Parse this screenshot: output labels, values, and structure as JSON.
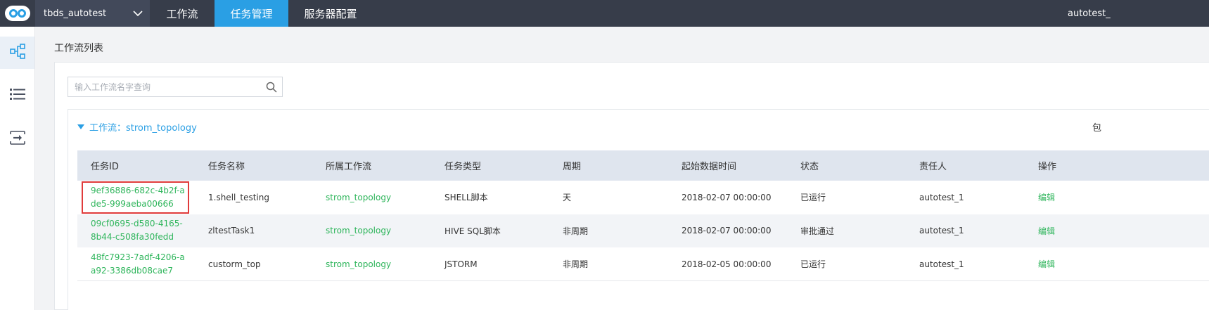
{
  "header": {
    "project": "tbds_autotest",
    "tabs": [
      {
        "label": "工作流"
      },
      {
        "label": "任务管理"
      },
      {
        "label": "服务器配置"
      }
    ],
    "user": "autotest_"
  },
  "sidebar": {
    "items": [
      "workflow-diagram-icon",
      "list-icon",
      "import-icon"
    ]
  },
  "page": {
    "title": "工作流列表",
    "search_placeholder": "输入工作流名字查询"
  },
  "workflow": {
    "header": "工作流：strom_topology",
    "right_text": "包"
  },
  "table": {
    "columns": [
      "任务ID",
      "任务名称",
      "所属工作流",
      "任务类型",
      "周期",
      "起始数据时间",
      "状态",
      "责任人",
      "操作"
    ],
    "rows": [
      {
        "id": "9ef36886-682c-4b2f-ade5-999aeba00666",
        "name": "1.shell_testing",
        "workflow": "strom_topology",
        "type": "SHELL脚本",
        "period": "天",
        "start_time": "2018-02-07 00:00:00",
        "status": "已运行",
        "owner": "autotest_1",
        "action": "编辑"
      },
      {
        "id": "09cf0695-d580-4165-8b44-c508fa30fedd",
        "name": "zltestTask1",
        "workflow": "strom_topology",
        "type": "HIVE SQL脚本",
        "period": "非周期",
        "start_time": "2018-02-07 00:00:00",
        "status": "审批通过",
        "owner": "autotest_1",
        "action": "编辑"
      },
      {
        "id": "48fc7923-7adf-4206-aa92-3386db08cae7",
        "name": "custorm_top",
        "workflow": "strom_topology",
        "type": "JSTORM",
        "period": "非周期",
        "start_time": "2018-02-05 00:00:00",
        "status": "已运行",
        "owner": "autotest_1",
        "action": "编辑"
      }
    ]
  },
  "colors": {
    "topbar": "#373d4a",
    "accent": "#2a9fe4",
    "link_green": "#2eb55b",
    "highlight": "#e03b3b"
  }
}
